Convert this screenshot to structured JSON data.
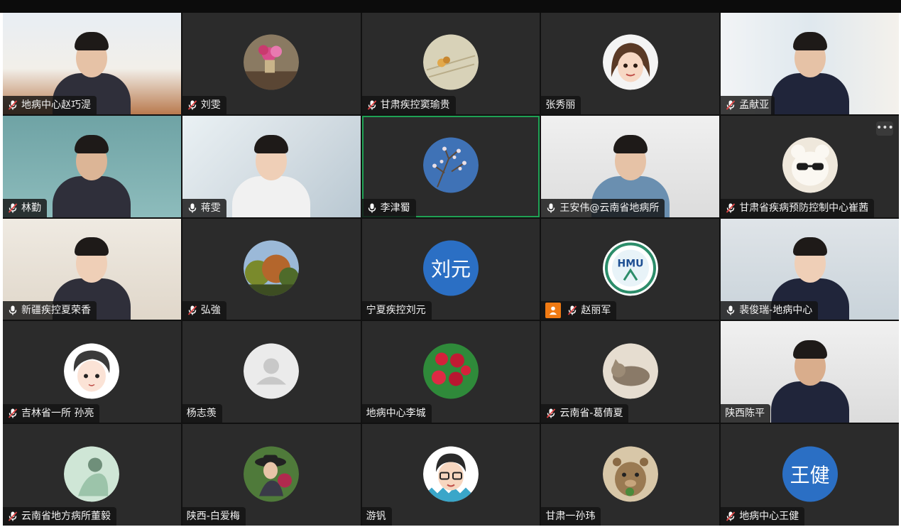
{
  "participants": [
    {
      "name": "地病中心赵巧湜",
      "mic": "muted",
      "view": "video",
      "scene": "s-room"
    },
    {
      "name": "刘雯",
      "mic": "muted",
      "view": "photo",
      "photo": "flowers"
    },
    {
      "name": "甘肃疾控窦瑜贵",
      "mic": "muted",
      "view": "photo",
      "photo": "paper-blossom"
    },
    {
      "name": "张秀丽",
      "mic": "none",
      "view": "photo",
      "photo": "cartoon-girl"
    },
    {
      "name": "孟献亚",
      "mic": "muted",
      "view": "video",
      "scene": "s-window"
    },
    {
      "name": "林勤",
      "mic": "muted",
      "view": "video",
      "scene": "s-teal"
    },
    {
      "name": "蒋雯",
      "mic": "on",
      "view": "video",
      "scene": "s-office"
    },
    {
      "name": "李津蜀",
      "mic": "on",
      "view": "photo",
      "photo": "blossom-sky",
      "active": true
    },
    {
      "name": "王安伟@云南省地病所",
      "mic": "on",
      "view": "video",
      "scene": "s-wall"
    },
    {
      "name": "甘肃省疾病预防控制中心崔茜",
      "mic": "muted",
      "view": "photo",
      "photo": "bear-sunglasses",
      "more": "•••"
    },
    {
      "name": "新疆疾控夏荣香",
      "mic": "on",
      "view": "video",
      "scene": "s-warm"
    },
    {
      "name": "弘強",
      "mic": "muted",
      "view": "photo",
      "photo": "autumn-trees"
    },
    {
      "name": "宁夏疾控刘元",
      "mic": "none",
      "view": "initials",
      "initials": "刘元"
    },
    {
      "name": "赵丽军",
      "mic": "muted",
      "view": "photo",
      "photo": "hmu-logo",
      "host": true
    },
    {
      "name": "裴俊瑞-地病中心",
      "mic": "on",
      "view": "video",
      "scene": "s-ceiling"
    },
    {
      "name": "吉林省一所  孙亮",
      "mic": "muted",
      "view": "photo",
      "photo": "anime-boy"
    },
    {
      "name": "杨志羡",
      "mic": "none",
      "view": "photo",
      "photo": "default-user"
    },
    {
      "name": "地病中心李城",
      "mic": "none",
      "view": "photo",
      "photo": "red-berries"
    },
    {
      "name": "云南省-葛倩夏",
      "mic": "muted",
      "view": "photo",
      "photo": "kitten"
    },
    {
      "name": "陕西陈平",
      "mic": "none",
      "view": "video",
      "scene": "s-wall"
    },
    {
      "name": "云南省地方病所董毅",
      "mic": "muted",
      "view": "photo",
      "photo": "green-person"
    },
    {
      "name": "陕西-白爱梅",
      "mic": "none",
      "view": "photo",
      "photo": "woman-hat"
    },
    {
      "name": "游钒",
      "mic": "none",
      "view": "photo",
      "photo": "cartoon-glasses"
    },
    {
      "name": "甘肃一孙玮",
      "mic": "none",
      "view": "photo",
      "photo": "quokka"
    },
    {
      "name": "地病中心王健",
      "mic": "muted",
      "view": "initials",
      "initials": "王健"
    }
  ],
  "colors": {
    "active_border": "#1fa254",
    "initials_bg": "#2b6fc4",
    "muted_mic": "#e04545",
    "host_badge": "#f07a13",
    "tile_bg": "#2b2b2b"
  }
}
